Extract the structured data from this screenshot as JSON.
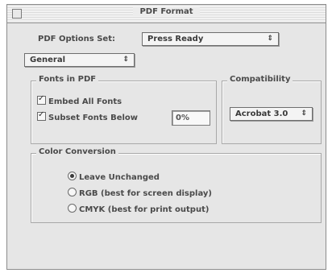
{
  "window": {
    "title": "PDF Format"
  },
  "options_set": {
    "label": "PDF Options Set:",
    "value": "Press Ready"
  },
  "panel_popup": {
    "value": "General"
  },
  "fonts_group": {
    "title": "Fonts in PDF",
    "embed_all": {
      "label": "Embed All Fonts",
      "checked": true
    },
    "subset_below": {
      "label": "Subset Fonts Below",
      "checked": true,
      "percent": "0%"
    }
  },
  "compat_group": {
    "title": "Compatibility",
    "value": "Acrobat 3.0"
  },
  "color_group": {
    "title": "Color Conversion",
    "options": [
      {
        "label": "Leave Unchanged",
        "selected": true
      },
      {
        "label": "RGB (best for screen display)",
        "selected": false
      },
      {
        "label": "CMYK (best for print output)",
        "selected": false
      }
    ]
  },
  "icons": {
    "popup_arrow": "⇕",
    "checkmark": "✓"
  }
}
